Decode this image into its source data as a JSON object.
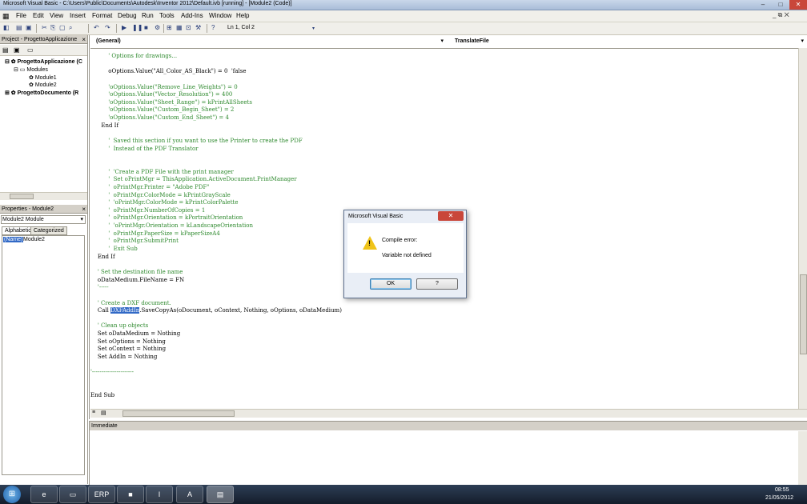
{
  "window": {
    "title": "Microsoft Visual Basic - C:\\Users\\Public\\Documents\\Autodesk\\Inventor 2012\\Default.ivb [running] - [Module2 (Code)]",
    "min": "–",
    "max": "□",
    "close": "✕"
  },
  "menu": {
    "items": [
      "File",
      "Edit",
      "View",
      "Insert",
      "Format",
      "Debug",
      "Run",
      "Tools",
      "Add-Ins",
      "Window",
      "Help"
    ],
    "right_controls": "_ ⧉ ✕"
  },
  "toolbar": {
    "position": "Ln 1, Col 2"
  },
  "project_panel": {
    "title": "Project - ProgettoApplicazione",
    "close": "×",
    "tree": [
      {
        "label": "ProgettoApplicazione (C",
        "bold": true
      },
      {
        "label": "Modules",
        "bold": false
      },
      {
        "label": "Module1",
        "bold": false
      },
      {
        "label": "Module2",
        "bold": false
      },
      {
        "label": "ProgettoDocumento (R",
        "bold": true
      }
    ]
  },
  "properties_panel": {
    "title": "Properties - Module2",
    "close": "×",
    "selected_object": "Module2 Module",
    "tabs": [
      "Alphabetic",
      "Categorized"
    ],
    "prop_name": "(Name)",
    "prop_value": "Module2"
  },
  "code_window": {
    "object_combo": "(General)",
    "procedure_combo": "TranslateFile",
    "highlight": "DXFAddIn",
    "lines": [
      {
        "text": "          ' Options for drawings...",
        "comment": true
      },
      {
        "text": "",
        "comment": false
      },
      {
        "text": "          oOptions.Value(\"All_Color_AS_Black\") = 0  'false",
        "comment": false
      },
      {
        "text": "",
        "comment": false
      },
      {
        "text": "          'oOptions.Value(\"Remove_Line_Weights\") = 0",
        "comment": true
      },
      {
        "text": "          'oOptions.Value(\"Vector_Resolution\") = 400",
        "comment": true
      },
      {
        "text": "          'oOptions.Value(\"Sheet_Range\") = kPrintAllSheets",
        "comment": true
      },
      {
        "text": "          'oOptions.Value(\"Custom_Begin_Sheet\") = 2",
        "comment": true
      },
      {
        "text": "          'oOptions.Value(\"Custom_End_Sheet\") = 4",
        "comment": true
      },
      {
        "text": "      End If",
        "comment": false
      },
      {
        "text": "",
        "comment": false
      },
      {
        "text": "          '  Saved this section if you want to use the Printer to create the PDF",
        "comment": true
      },
      {
        "text": "          '  Instead of the PDF Translator",
        "comment": true
      },
      {
        "text": "",
        "comment": false
      },
      {
        "text": "",
        "comment": false
      },
      {
        "text": "          '  'Create a PDF File with the print manager",
        "comment": true
      },
      {
        "text": "          '  Set oPrintMgr = ThisApplication.ActiveDocument.PrintManager",
        "comment": true
      },
      {
        "text": "          '  oPrintMgr.Printer = \"Adobe PDF\"",
        "comment": true
      },
      {
        "text": "          '  oPrintMgr.ColorMode = kPrintGrayScale",
        "comment": true
      },
      {
        "text": "          '  'oPrintMgr.ColorMode = kPrintColorPalette",
        "comment": true
      },
      {
        "text": "          '  oPrintMgr.NumberOfCopies = 1",
        "comment": true
      },
      {
        "text": "          '  oPrintMgr.Orientation = kPortraitOrientation",
        "comment": true
      },
      {
        "text": "          '  'oPrintMgr.Orientation = kLandscapeOrientation",
        "comment": true
      },
      {
        "text": "          '  oPrintMgr.PaperSize = kPaperSizeA4",
        "comment": true
      },
      {
        "text": "          '  oPrintMgr.SubmitPrint",
        "comment": true
      },
      {
        "text": "          '  Exit Sub",
        "comment": true
      },
      {
        "text": "    End If",
        "comment": false
      },
      {
        "text": "",
        "comment": false
      },
      {
        "text": "    ' Set the destination file name",
        "comment": true
      },
      {
        "text": "    oDataMedium.FileName = FN",
        "comment": false
      },
      {
        "text": "    '-----",
        "comment": true
      },
      {
        "text": "",
        "comment": false
      },
      {
        "text": "    ' Create a DXF document.",
        "comment": true
      },
      {
        "text": "    Call DXFAddIn.SaveCopyAs(oDocument, oContext, Nothing, oOptions, oDataMedium)",
        "comment": false
      },
      {
        "text": "",
        "comment": false
      },
      {
        "text": "    ' Clean up objects",
        "comment": true
      },
      {
        "text": "    Set oDataMedium = Nothing",
        "comment": false
      },
      {
        "text": "    Set oOptions = Nothing",
        "comment": false
      },
      {
        "text": "    Set oContext = Nothing",
        "comment": false
      },
      {
        "text": "    Set AddIn = Nothing",
        "comment": false
      },
      {
        "text": "",
        "comment": false
      },
      {
        "text": "'----------------------",
        "comment": true
      },
      {
        "text": "",
        "comment": false
      },
      {
        "text": "",
        "comment": false
      },
      {
        "text": "End Sub",
        "comment": false
      }
    ]
  },
  "immediate": {
    "title": "Immediate"
  },
  "dialog": {
    "title": "Microsoft Visual Basic",
    "close": "✕",
    "message": "Compile error:",
    "detail": "Variable not defined",
    "ok": "OK",
    "help": "?"
  },
  "taskbar": {
    "tasks": [
      {
        "name": "ie",
        "label": "e"
      },
      {
        "name": "explorer",
        "label": "▭"
      },
      {
        "name": "erp",
        "label": "ERP"
      },
      {
        "name": "app",
        "label": "■"
      },
      {
        "name": "inventor",
        "label": "I"
      },
      {
        "name": "pdf",
        "label": "A"
      },
      {
        "name": "vb",
        "label": "▤"
      }
    ],
    "time": "08:55",
    "date": "21/05/2012"
  },
  "colors": {
    "comment": "#2f8a2f",
    "highlight": "#3169c6"
  }
}
